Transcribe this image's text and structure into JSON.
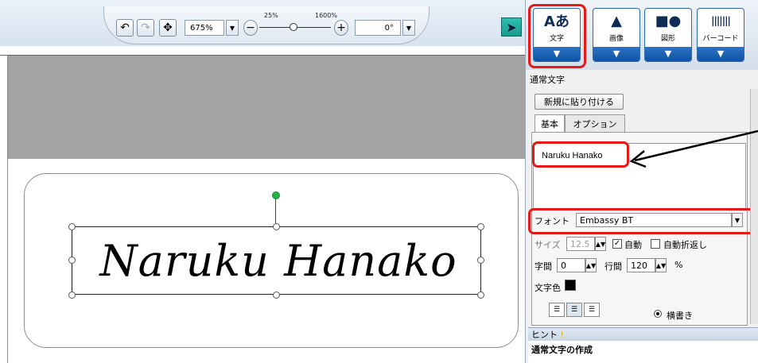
{
  "toolbar": {
    "zoom_value": "675%",
    "zoom_min_label": "25%",
    "zoom_max_label": "1600%",
    "rotation_value": "0°"
  },
  "canvas": {
    "signature_text": "Naruku Hanako"
  },
  "object_buttons": [
    {
      "label": "文字",
      "icon": "text-icon",
      "glyph": "Aあ"
    },
    {
      "label": "画像",
      "icon": "image-icon",
      "glyph": "▲"
    },
    {
      "label": "図形",
      "icon": "shape-icon",
      "glyph": "■●"
    },
    {
      "label": "バーコード",
      "icon": "barcode-icon",
      "glyph": "|||||||"
    }
  ],
  "panel": {
    "header": "通常文字",
    "paste_button": "新規に貼り付ける",
    "tabs": [
      "基本",
      "オプション"
    ],
    "text_value": "Naruku Hanako",
    "font_label": "フォント",
    "font_value": "Embassy BT",
    "size_label": "サイズ",
    "size_value": "12.5",
    "auto_label": "自動",
    "autowrap_label": "自動折返し",
    "char_spacing_label": "字間",
    "char_spacing_value": "0",
    "line_spacing_label": "行間",
    "line_spacing_value": "120",
    "percent": "%",
    "color_label": "文字色",
    "horizontal_label": "横書き"
  },
  "hint": {
    "title": "ヒント",
    "body": "通常文字の作成"
  },
  "colors": {
    "highlight": "#e81818",
    "accent": "#1351a0",
    "rotate_handle": "#22b14c"
  }
}
